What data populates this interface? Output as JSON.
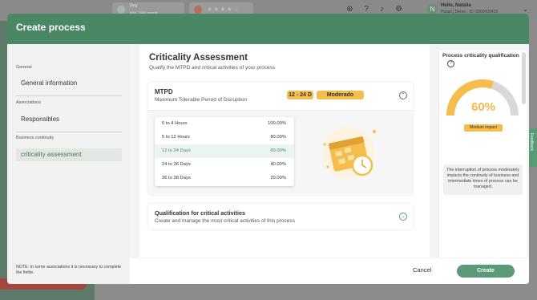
{
  "background": {
    "pro_label": "Pro",
    "pro_sub": "86% - 5000 records",
    "stars": "★★★★☆",
    "user_initial": "N",
    "hello": "Hello, Natalia",
    "user_sub": "Pizani | Demo - ID: 0000000419"
  },
  "modal": {
    "title": "Create process"
  },
  "sidebar": {
    "groups": [
      {
        "label": "General",
        "item": "General information"
      },
      {
        "label": "Associations",
        "item": "Responsibles"
      },
      {
        "label": "Business continuity",
        "item": "criticality assessment"
      }
    ],
    "note": "NOTE: In some associations it is necessary to complete the fields."
  },
  "section": {
    "title": "Criticality Assessment",
    "subtitle": "Qualify the MTPD and critical activities of your process"
  },
  "mtpd": {
    "title": "MTPD",
    "subtitle": "Maximum Tolerable Period of Disruption",
    "range": "12 - 24 D",
    "level": "Moderado",
    "rows": [
      {
        "label": "0 to 4 Hours",
        "value": "100.00%"
      },
      {
        "label": "5 to 12 Hours",
        "value": "80.00%"
      },
      {
        "label": "12 to 24 Days",
        "value": "60.00%"
      },
      {
        "label": "24 to 36 Days",
        "value": "40.00%"
      },
      {
        "label": "36 to 38 Days",
        "value": "20.00%"
      }
    ]
  },
  "qualification": {
    "title": "Qualification for critical activities",
    "subtitle": "Create and manage the most critical activities of this process"
  },
  "panel": {
    "title": "Process criticality qualification",
    "value": "60%",
    "impact": "Medium impact",
    "description": "The interruption of process moderately impacts the continuity of business and intermediate times of process can be managed."
  },
  "footer": {
    "cancel": "Cancel",
    "create": "Create"
  },
  "feedback": "Feedback",
  "colors": {
    "brand": "#4a8764",
    "accent": "#f4bd4c",
    "button": "#5a9a76"
  }
}
